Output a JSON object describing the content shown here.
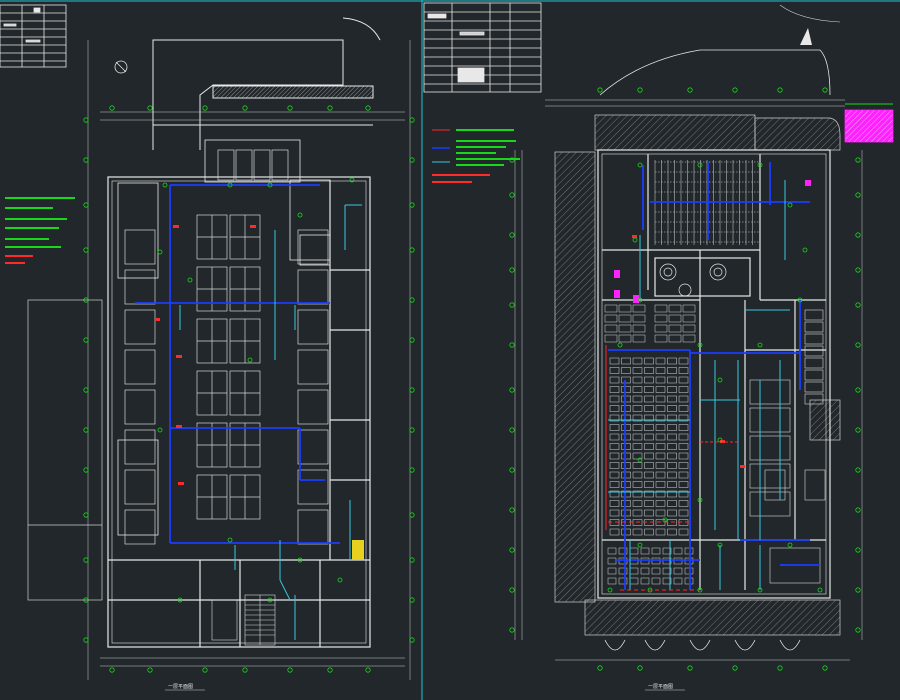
{
  "drawing": {
    "background": "#21272b",
    "colors": {
      "wall": "#e8e8e8",
      "dim": "#cfcfcf",
      "axis_marker": "#19d819",
      "pipe_main": "#1c3cff",
      "pipe_branch": "#38c8e0",
      "alarm": "#ff2a2a",
      "special": "#ff22ff",
      "hatch": "#9a9a9a"
    },
    "left_sheet": {
      "name": "plan-left",
      "caption": "一层平面图"
    },
    "right_sheet": {
      "name": "plan-right",
      "caption": "一层平面图"
    }
  }
}
